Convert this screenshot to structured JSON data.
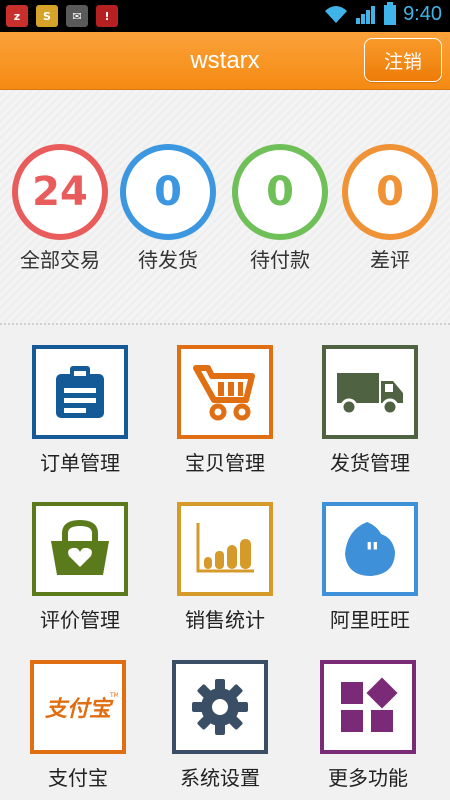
{
  "status_bar": {
    "time": "9:40",
    "notifications": [
      "z-app-icon",
      "s-app-icon",
      "mail-app-icon",
      "alert-app-icon"
    ]
  },
  "header": {
    "title": "wstarx",
    "logout_label": "注销"
  },
  "stats": [
    {
      "value": "24",
      "label": "全部交易",
      "color": "#e95c5c"
    },
    {
      "value": "0",
      "label": "待发货",
      "color": "#3c97e0"
    },
    {
      "value": "0",
      "label": "待付款",
      "color": "#70c05a"
    },
    {
      "value": "0",
      "label": "差评",
      "color": "#f09236"
    }
  ],
  "menu": [
    {
      "label": "订单管理",
      "icon": "clipboard-icon",
      "color": "#145a96"
    },
    {
      "label": "宝贝管理",
      "icon": "cart-icon",
      "color": "#e06e12"
    },
    {
      "label": "发货管理",
      "icon": "truck-icon",
      "color": "#4f6242"
    },
    {
      "label": "评价管理",
      "icon": "basket-heart-icon",
      "color": "#5a7a1c"
    },
    {
      "label": "销售统计",
      "icon": "bar-chart-icon",
      "color": "#d59a2a"
    },
    {
      "label": "阿里旺旺",
      "icon": "chat-bubble-icon",
      "color": "#3e90d8"
    },
    {
      "label": "支付宝",
      "icon": "alipay-logo",
      "logo_text": "支付宝",
      "color": "#e06e12"
    },
    {
      "label": "系统设置",
      "icon": "gear-icon",
      "color": "#3a4f66"
    },
    {
      "label": "更多功能",
      "icon": "more-icon",
      "color": "#7b2a78"
    }
  ]
}
